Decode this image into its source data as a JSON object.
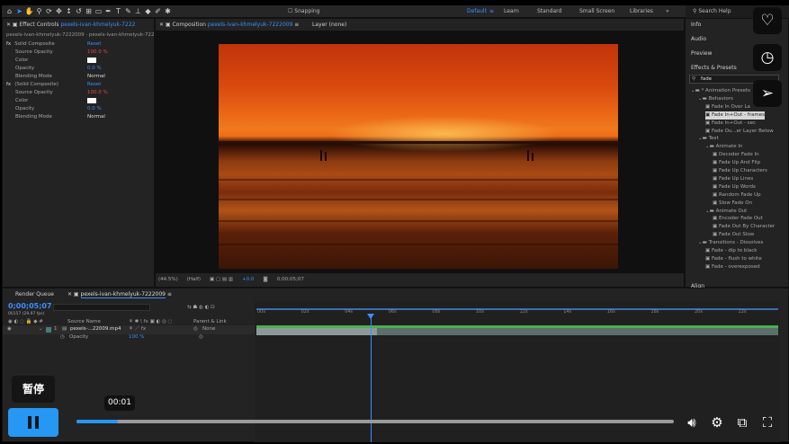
{
  "toolbar": {
    "snapping_label": "Snapping",
    "workspaces": [
      "Default",
      "Learn",
      "Standard",
      "Small Screen",
      "Libraries"
    ],
    "search_placeholder": "Search Help",
    "more_glyph": "»"
  },
  "effect_controls": {
    "tab_label": "Effect Controls",
    "tab_layer": "pexels-ivan-khmelyuk-7222",
    "breadcrumb": "pexels-ivan-khmelyuk-7222009 · pexels-ivan-khmelyuk-7222009",
    "groups": [
      {
        "fx": "fx",
        "name": "Solid Composite",
        "reset": "Reset",
        "props": [
          {
            "name": "Source Opacity",
            "value": "100.0 %"
          },
          {
            "name": "Color",
            "value": ""
          },
          {
            "name": "Opacity",
            "value": "0.0 %"
          },
          {
            "name": "Blending Mode",
            "value": "Normal"
          }
        ]
      },
      {
        "fx": "fx",
        "name": "(Solid Composite)",
        "reset": "Reset",
        "props": [
          {
            "name": "Source Opacity",
            "value": "100.0 %"
          },
          {
            "name": "Color",
            "value": ""
          },
          {
            "name": "Opacity",
            "value": "0.0 %"
          },
          {
            "name": "Blending Mode",
            "value": "Normal"
          }
        ]
      }
    ]
  },
  "composition": {
    "tab_label": "Composition",
    "tab_name": "pexels-ivan-khmelyuk-7222009",
    "layer_tab": "Layer (none)",
    "subtab": "pexels-ivan-khmelyuk-7222009",
    "zoom": "(44.5%)",
    "resolution": "(Half)",
    "exposure": "+0.0",
    "timecode": "0;00;05;07"
  },
  "right_panels": {
    "info": "Info",
    "audio": "Audio",
    "preview": "Preview",
    "effects_presets": "Effects & Presets",
    "search_value": "fade",
    "tree": [
      {
        "label": "* Animation Presets",
        "level": 0
      },
      {
        "label": "Behaviors",
        "level": 1
      },
      {
        "label": "Fade In Over La",
        "level": 2
      },
      {
        "label": "Fade In+Out - frames",
        "level": 2,
        "selected": true
      },
      {
        "label": "Fade In+Out - sec",
        "level": 2
      },
      {
        "label": "Fade Ou...er Layer Below",
        "level": 2
      },
      {
        "label": "Text",
        "level": 1
      },
      {
        "label": "Animate In",
        "level": 2
      },
      {
        "label": "Decoder Fade In",
        "level": 3
      },
      {
        "label": "Fade Up And Flip",
        "level": 3
      },
      {
        "label": "Fade Up Characters",
        "level": 3
      },
      {
        "label": "Fade Up Lines",
        "level": 3
      },
      {
        "label": "Fade Up Words",
        "level": 3
      },
      {
        "label": "Random Fade Up",
        "level": 3
      },
      {
        "label": "Slow Fade On",
        "level": 3
      },
      {
        "label": "Animate Out",
        "level": 2
      },
      {
        "label": "Encoder Fade Out",
        "level": 3
      },
      {
        "label": "Fade Out By Character",
        "level": 3
      },
      {
        "label": "Fade Out Slow",
        "level": 3
      },
      {
        "label": "Transitions - Dissolves",
        "level": 1
      },
      {
        "label": "Fade - dip to black",
        "level": 2
      },
      {
        "label": "Fade - flush to white",
        "level": 2
      },
      {
        "label": "Fade - overexposed",
        "level": 2
      }
    ],
    "align": "Align"
  },
  "timeline": {
    "render_queue": "Render Queue",
    "comp_tab": "pexels-ivan-khmelyuk-7222009",
    "timecode": "0;00;05;07",
    "frames": "00157 (29.97 fps)",
    "col_source": "Source Name",
    "col_parent": "Parent & Link",
    "layer_index": "1",
    "layer_name": "pexels-...22009.mp4",
    "parent": "None",
    "opacity_label": "Opacity",
    "opacity_value": "100 %",
    "ticks": [
      "00s",
      "02s",
      "04s",
      "06s",
      "08s",
      "10s",
      "12s",
      "14s",
      "16s",
      "18s",
      "20s",
      "22s"
    ]
  },
  "player": {
    "tooltip": "暂停",
    "time": "00:01",
    "progress": 0.07,
    "accent": "#2697f3"
  },
  "side_actions": {
    "like": "heart-icon",
    "history": "clock-icon",
    "share": "send-icon"
  }
}
